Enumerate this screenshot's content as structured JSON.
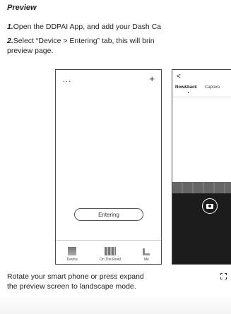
{
  "heading": "Preview",
  "steps": [
    {
      "num": "1.",
      "text": "Open the DDPAI App, and add your Dash Ca"
    },
    {
      "num": "2.",
      "text": "Select “Device > Entering” tab, this will brin"
    }
  ],
  "step2_cont": "preview page.",
  "phone_left": {
    "menu_dots": "...",
    "add_glyph": "+",
    "button_label": "Entering",
    "nav": [
      {
        "label": "Device",
        "icon": "device-icon"
      },
      {
        "label": "On The Road",
        "icon": "road-icon"
      },
      {
        "label": "Me",
        "icon": "me-icon"
      }
    ]
  },
  "phone_right": {
    "back_glyph": "<",
    "tabs": [
      "Now&back",
      "Capture"
    ],
    "camera_icon": "camera-icon"
  },
  "rotate_line1": "Rotate your smart phone or press expand",
  "rotate_line2": "the preview screen to landscape mode."
}
